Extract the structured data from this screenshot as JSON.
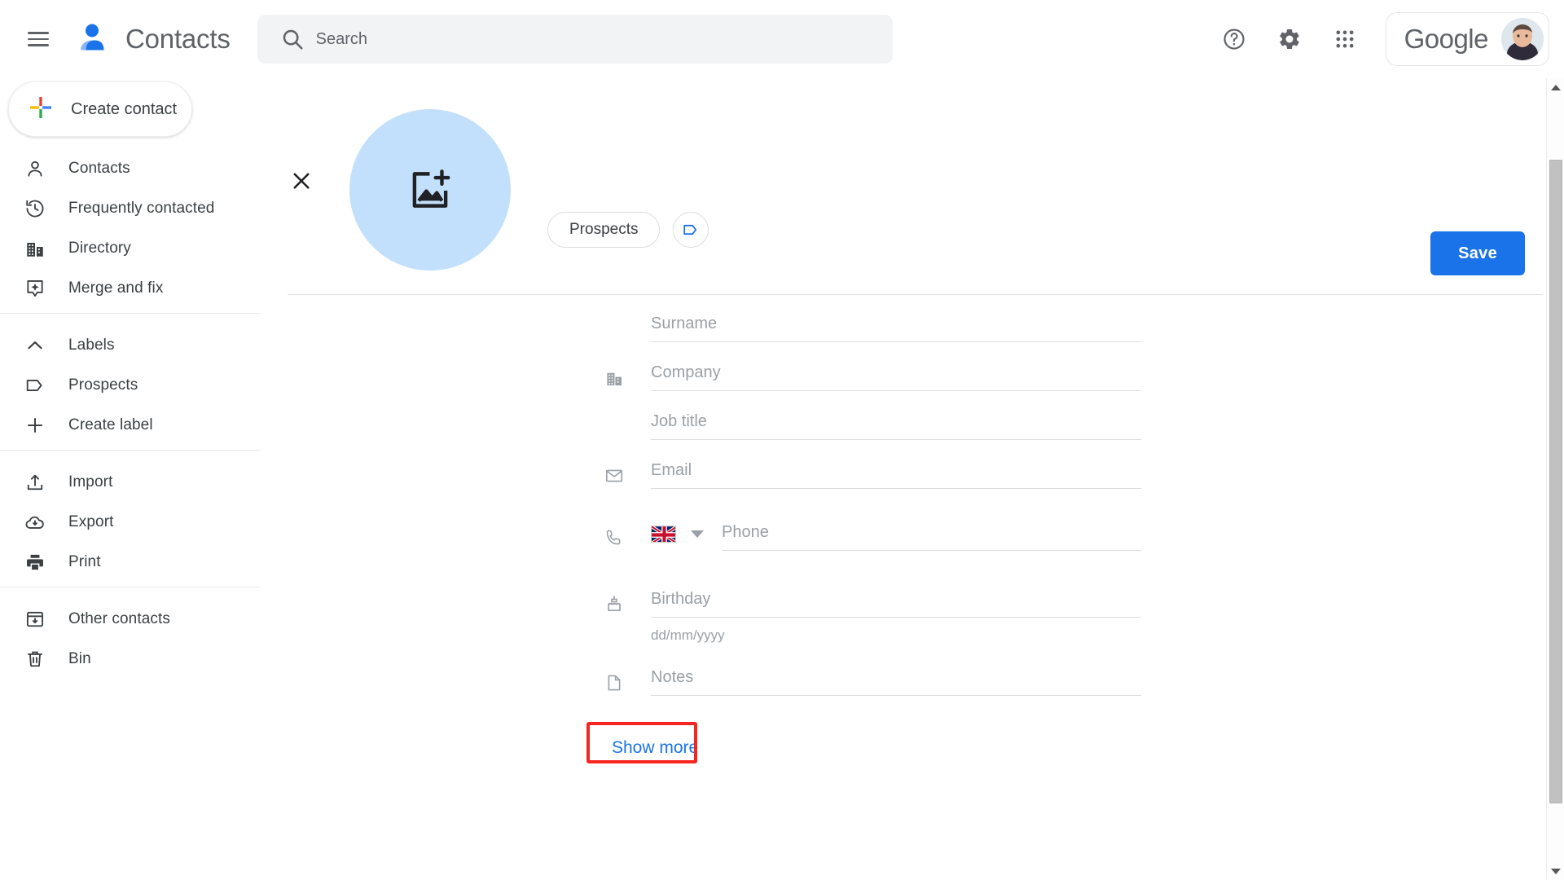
{
  "app": {
    "title": "Contacts",
    "brand_icon": "contacts-person-icon"
  },
  "topbar": {
    "menu_icon": "hamburger-menu-icon",
    "search": {
      "placeholder": "Search",
      "value": "",
      "icon": "search-icon"
    },
    "help_icon": "help-question-circle-icon",
    "settings_icon": "gear-icon",
    "apps_icon": "apps-grid-icon",
    "account": {
      "brand_word": "Google",
      "avatar_icon": "user-avatar-photo"
    }
  },
  "sidebar": {
    "create_button": {
      "label": "Create contact",
      "icon": "plus-colored-icon"
    },
    "groups": [
      {
        "items": [
          {
            "label": "Contacts",
            "icon": "person-icon"
          },
          {
            "label": "Frequently contacted",
            "icon": "history-clock-icon"
          },
          {
            "label": "Directory",
            "icon": "building-icon"
          },
          {
            "label": "Merge and fix",
            "icon": "merge-sparkle-icon"
          }
        ]
      },
      {
        "items": [
          {
            "label": "Labels",
            "icon": "chevron-up-icon"
          },
          {
            "label": "Prospects",
            "icon": "label-tag-icon"
          },
          {
            "label": "Create label",
            "icon": "plus-icon"
          }
        ]
      },
      {
        "items": [
          {
            "label": "Import",
            "icon": "upload-icon"
          },
          {
            "label": "Export",
            "icon": "cloud-download-icon"
          },
          {
            "label": "Print",
            "icon": "printer-icon"
          }
        ]
      },
      {
        "items": [
          {
            "label": "Other contacts",
            "icon": "archive-box-icon"
          },
          {
            "label": "Bin",
            "icon": "trash-bin-icon"
          }
        ]
      }
    ]
  },
  "editor": {
    "close_icon": "close-x-icon",
    "photo": {
      "icon": "add-photo-icon",
      "background_color": "#c2e0fc"
    },
    "label_chip": {
      "label": "Prospects"
    },
    "add_label_button": {
      "icon": "label-tag-icon"
    },
    "save_button": {
      "label": "Save",
      "color": "#1a73e8"
    },
    "fields": [
      {
        "name": "surname",
        "placeholder": "Surname",
        "value": "",
        "icon": "",
        "hint": ""
      },
      {
        "name": "company",
        "placeholder": "Company",
        "value": "",
        "icon": "building-icon",
        "hint": ""
      },
      {
        "name": "job-title",
        "placeholder": "Job title",
        "value": "",
        "icon": "",
        "hint": ""
      },
      {
        "name": "email",
        "placeholder": "Email",
        "value": "",
        "icon": "envelope-icon",
        "hint": ""
      },
      {
        "name": "birthday",
        "placeholder": "Birthday",
        "value": "",
        "icon": "birthday-cake-icon",
        "hint": "dd/mm/yyyy"
      },
      {
        "name": "notes",
        "placeholder": "Notes",
        "value": "",
        "icon": "note-page-icon",
        "hint": ""
      }
    ],
    "phone_field": {
      "placeholder": "Phone",
      "value": "",
      "icon": "phone-icon",
      "country_flag": "uk-flag",
      "dropdown_icon": "caret-down-icon"
    },
    "show_more": {
      "label": "Show more",
      "highlight_color": "#f6251f"
    }
  },
  "scrollbar": {
    "up_icon": "scroll-up-arrow-icon",
    "down_icon": "scroll-down-arrow-icon"
  }
}
